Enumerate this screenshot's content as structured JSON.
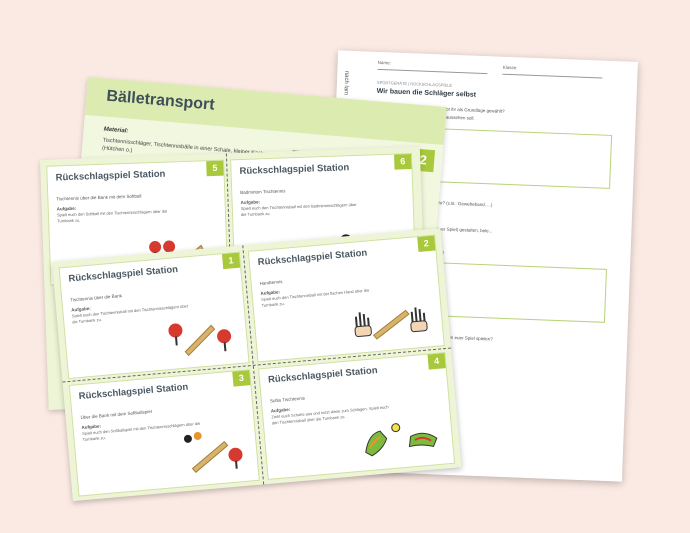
{
  "worksheet": {
    "side_label": "nach lam",
    "name_label": "Name:",
    "klasse_label": "Klasse:",
    "kicker": "SPORTGERÄTE | RÜCKSCHLAGSPIELE",
    "title": "Wir bauen die Schläger selbst",
    "lines": [
      "habt ihr als Grundlage gewählt?",
      "er aussehen soll.",
      "ihr? (z.B.: Gewebeband, ...)",
      "euer Spiel) gestalten, bele...",
      "ebt?",
      "ihr können euer Spiel spielen?",
      "ebt?",
      "es noch?"
    ]
  },
  "balle": {
    "title": "Bälletransport",
    "number": "2",
    "material_label": "Material:",
    "text": "Tischtennisschläger, Tischtennisbälle in einer Schale, kleiner Kasten, Markierung (Hütchen o.)"
  },
  "cards": [
    {
      "title": "Rückschlagspiel Station",
      "number": "5",
      "sub": "Tischtennis über die Bank mit dem Softball",
      "aufgabe": "Aufgabe:",
      "task": "Spielt euch den Softball mit den Tischtennisschlägern über die Turnbank zu."
    },
    {
      "title": "Rückschlagspiel Station",
      "number": "6",
      "sub": "Badminton Tischtennis",
      "aufgabe": "Aufgabe:",
      "task": "Spielt euch den Tischtennisball mit den Badmintonschlägern über die Turnbank zu."
    },
    {
      "title": "Rückschlagspiel Station",
      "number": "1",
      "sub": "Tischtennis über die Bank",
      "aufgabe": "Aufgabe:",
      "task": "Spielt euch den Tischtennisball mit den Tischtennisschlägern über die Turnbank zu."
    },
    {
      "title": "Rückschlagspiel Station",
      "number": "2",
      "sub": "Handtennis",
      "aufgabe": "Aufgabe:",
      "task": "Spielt euch den Tischtennisball mit der flachen Hand über die Turnbank zu."
    },
    {
      "title": "Rückschlagspiel Station",
      "number": "3",
      "sub": "Über die Bank mit dem Softballspiel",
      "aufgabe": "Aufgabe:",
      "task": "Spielt euch den Softballspiel mit den Tischtennisschlägern über die Turnbank zu."
    },
    {
      "title": "Rückschlagspiel Station",
      "number": "4",
      "sub": "Softis Tischtennis",
      "aufgabe": "Aufgabe:",
      "task": "Zieht euch Schuhe aus und nutzt diese zum Schlagen. Spielt euch den Tischtennisball über die Turnbank zu."
    }
  ]
}
